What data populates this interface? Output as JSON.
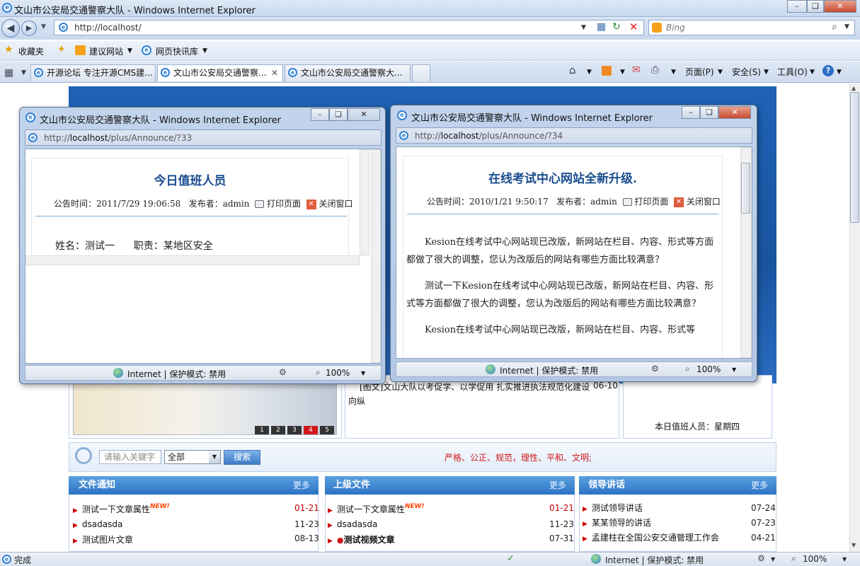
{
  "browser": {
    "title": "文山市公安局交通警察大队 - Windows Internet Explorer",
    "address": "http://localhost/",
    "search_placeholder": "Bing",
    "favorites": {
      "label": "收藏夹",
      "items": [
        "建议网站",
        "网页快讯库"
      ]
    },
    "tabs": [
      {
        "label": "开源论坛 专注开源CMS建..."
      },
      {
        "label": "文山市公安局交通警察..."
      },
      {
        "label": "文山市公安局交通警察大..."
      }
    ],
    "toolbar": {
      "page": "页面(P)",
      "safety": "安全(S)",
      "tools": "工具(O)"
    },
    "status": {
      "left": "完成",
      "zone": "Internet | 保护模式: 禁用",
      "zoom": "100%"
    }
  },
  "page": {
    "news_snippet": "[图文]文山大队以考促学、以学促用 扎实推进执法规范化建设",
    "news_snippet_date": "06-10",
    "news_snippet_cont": "向纵",
    "duty_label": "本日值班人员：星期四",
    "slide_numbers": [
      "1",
      "2",
      "3",
      "4",
      "5"
    ],
    "search": {
      "placeholder": "请输入关键字",
      "select": "全部",
      "button": "搜索",
      "slogan": "严格、公正、规范，理性、平和、文明;"
    },
    "columns": [
      {
        "title": "文件通知",
        "more": "更多",
        "items": [
          {
            "text": "测试一下文章属性",
            "new": "NEW!",
            "date": "01-21",
            "date_red": true
          },
          {
            "text": "dsadasda",
            "date": "11-23"
          },
          {
            "text": "测试图片文章",
            "date": "08-13"
          }
        ]
      },
      {
        "title": "上级文件",
        "more": "更多",
        "items": [
          {
            "text": "测试一下文章属性",
            "new": "NEW!",
            "date": "01-21",
            "date_red": true
          },
          {
            "text": "dsadasda",
            "date": "11-23"
          },
          {
            "text": "测试视频文章",
            "date": "07-31",
            "bold": true
          }
        ]
      },
      {
        "title": "领导讲话",
        "more": "更多",
        "items": [
          {
            "text": "测试领导讲话",
            "date": "07-24"
          },
          {
            "text": "某某领导的讲话",
            "date": "07-23"
          },
          {
            "text": "孟建柱在全国公安交通管理工作会",
            "date": "04-21"
          }
        ]
      }
    ]
  },
  "popup1": {
    "title": "文山市公安局交通警察大队 - Windows Internet Explorer",
    "address_prefix": "http://",
    "address_host": "localhost",
    "address_path": "/plus/Announce/?33",
    "heading": "今日值班人员",
    "meta_time": "公告时间：2011/7/29 19:06:58",
    "meta_pub": "发布者：admin",
    "print": "打印页面",
    "close": "关闭窗口",
    "body": "姓名：测试一      职责：某地区安全",
    "status_zone": "Internet | 保护模式: 禁用",
    "zoom": "100%"
  },
  "popup2": {
    "title": "文山市公安局交通警察大队 - Windows Internet Explorer",
    "address_prefix": "http://",
    "address_host": "localhost",
    "address_path": "/plus/Announce/?34",
    "heading": "在线考试中心网站全新升级.",
    "meta_time": "公告时间：2010/1/21 9:50:17",
    "meta_pub": "发布者：admin",
    "print": "打印页面",
    "close": "关闭窗口",
    "paragraphs": [
      "Kesion在线考试中心网站现已改版，新网站在栏目、内容、形式等方面都做了很大的调整，您认为改版后的网站有哪些方面比较满意？",
      "测试一下Kesion在线考试中心网站现已改版，新网站在栏目、内容、形式等方面都做了很大的调整，您认为改版后的网站有哪些方面比较满意？",
      "Kesion在线考试中心网站现已改版，新网站在栏目、内容、形式等"
    ],
    "status_zone": "Internet | 保护模式: 禁用",
    "zoom": "100%"
  }
}
